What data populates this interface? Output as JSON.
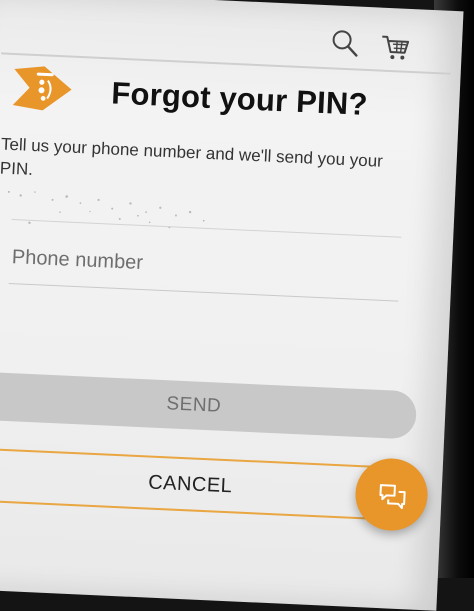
{
  "header": {
    "search_icon": "search-icon",
    "cart_icon": "cart-icon"
  },
  "brand": {
    "logo_icon": "brand-logo",
    "accent_color": "#e8952a"
  },
  "main": {
    "title": "Forgot your PIN?",
    "description": "Tell us your phone number and we'll send you your PIN.",
    "phone_field": {
      "placeholder": "Phone number",
      "value": ""
    },
    "send_label": "SEND",
    "cancel_label": "CANCEL"
  },
  "chat": {
    "icon": "chat-icon"
  }
}
